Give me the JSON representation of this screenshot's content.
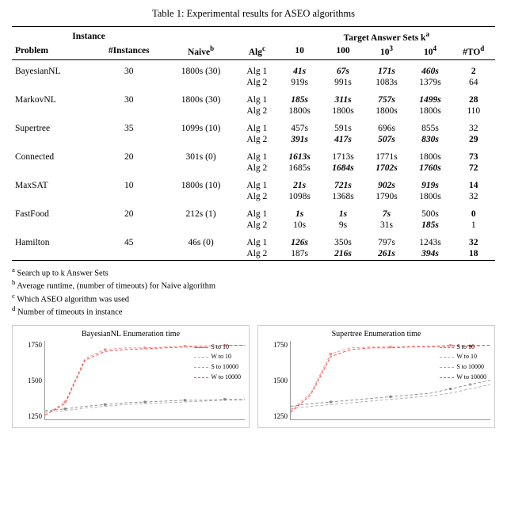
{
  "caption": "Table 1: Experimental results for ASEO algorithms",
  "header": {
    "col1": "Problem",
    "col2": "#Instances",
    "col3": "Naive",
    "col3_sup": "b",
    "col4": "Alg",
    "col4_sup": "c",
    "target_label": "Target Answer Sets k",
    "target_sup": "a",
    "col5": "10",
    "col6": "100",
    "col7": "10³",
    "col8": "10⁴",
    "col9": "#TO",
    "col9_sup": "d",
    "instance_label": "Instance"
  },
  "rows": [
    {
      "problem": "BayesianNL",
      "instances": "30",
      "naive": "1800s (30)",
      "alg": "Alg 1",
      "k10": "41s",
      "k100": "67s",
      "k1000": "171s",
      "k10000": "460s",
      "to": "2",
      "bold_cols": [
        "k10",
        "k100",
        "k1000",
        "k10000",
        "to"
      ],
      "italic_cols": [
        "k10",
        "k100",
        "k1000",
        "k10000"
      ],
      "group": "BayesianNL"
    },
    {
      "problem": "",
      "instances": "",
      "naive": "",
      "alg": "Alg 2",
      "k10": "919s",
      "k100": "991s",
      "k1000": "1083s",
      "k10000": "1379s",
      "to": "64",
      "bold_cols": [],
      "italic_cols": [],
      "group": "BayesianNL"
    },
    {
      "problem": "MarkovNL",
      "instances": "30",
      "naive": "1800s (30)",
      "alg": "Alg 1",
      "k10": "185s",
      "k100": "311s",
      "k1000": "757s",
      "k10000": "1499s",
      "to": "28",
      "bold_cols": [
        "k10",
        "k100",
        "k1000",
        "k10000",
        "to"
      ],
      "italic_cols": [
        "k10",
        "k100",
        "k1000",
        "k10000"
      ],
      "group": "MarkovNL"
    },
    {
      "problem": "",
      "instances": "",
      "naive": "",
      "alg": "Alg 2",
      "k10": "1800s",
      "k100": "1800s",
      "k1000": "1800s",
      "k10000": "1800s",
      "to": "110",
      "bold_cols": [],
      "italic_cols": [],
      "group": "MarkovNL"
    },
    {
      "problem": "Supertree",
      "instances": "35",
      "naive": "1099s (10)",
      "alg": "Alg 1",
      "k10": "457s",
      "k100": "591s",
      "k1000": "696s",
      "k10000": "855s",
      "to": "32",
      "bold_cols": [],
      "italic_cols": [],
      "group": "Supertree"
    },
    {
      "problem": "",
      "instances": "",
      "naive": "",
      "alg": "Alg 2",
      "k10": "391s",
      "k100": "417s",
      "k1000": "507s",
      "k10000": "830s",
      "to": "29",
      "bold_cols": [
        "k10",
        "k100",
        "k1000",
        "k10000",
        "to"
      ],
      "italic_cols": [
        "k10",
        "k100",
        "k1000",
        "k10000"
      ],
      "group": "Supertree"
    },
    {
      "problem": "Connected",
      "instances": "20",
      "naive": "301s (0)",
      "alg": "Alg 1",
      "k10": "1613s",
      "k100": "1713s",
      "k1000": "1771s",
      "k10000": "1800s",
      "to": "73",
      "bold_cols": [
        "k10",
        "to"
      ],
      "italic_cols": [
        "k10"
      ],
      "group": "Connected"
    },
    {
      "problem": "",
      "instances": "",
      "naive": "",
      "alg": "Alg 2",
      "k10": "1685s",
      "k100": "1684s",
      "k1000": "1702s",
      "k10000": "1760s",
      "to": "72",
      "bold_cols": [
        "k100",
        "k1000",
        "k10000",
        "to"
      ],
      "italic_cols": [
        "k100",
        "k1000",
        "k10000"
      ],
      "group": "Connected"
    },
    {
      "problem": "MaxSAT",
      "instances": "10",
      "naive": "1800s (10)",
      "alg": "Alg 1",
      "k10": "21s",
      "k100": "721s",
      "k1000": "902s",
      "k10000": "919s",
      "to": "14",
      "bold_cols": [
        "k10",
        "k100",
        "k1000",
        "k10000",
        "to"
      ],
      "italic_cols": [
        "k10",
        "k100",
        "k1000",
        "k10000"
      ],
      "group": "MaxSAT"
    },
    {
      "problem": "",
      "instances": "",
      "naive": "",
      "alg": "Alg 2",
      "k10": "1098s",
      "k100": "1368s",
      "k1000": "1790s",
      "k10000": "1800s",
      "to": "32",
      "bold_cols": [],
      "italic_cols": [],
      "group": "MaxSAT"
    },
    {
      "problem": "FastFood",
      "instances": "20",
      "naive": "212s (1)",
      "alg": "Alg 1",
      "k10": "1s",
      "k100": "1s",
      "k1000": "7s",
      "k10000": "500s",
      "to": "0",
      "bold_cols": [
        "k10",
        "k100",
        "k1000",
        "to"
      ],
      "italic_cols": [
        "k10",
        "k100",
        "k1000"
      ],
      "group": "FastFood"
    },
    {
      "problem": "",
      "instances": "",
      "naive": "",
      "alg": "Alg 2",
      "k10": "10s",
      "k100": "9s",
      "k1000": "31s",
      "k10000": "185s",
      "to": "1",
      "bold_cols": [
        "k10000"
      ],
      "italic_cols": [
        "k10000"
      ],
      "group": "FastFood"
    },
    {
      "problem": "Hamilton",
      "instances": "45",
      "naive": "46s (0)",
      "alg": "Alg 1",
      "k10": "126s",
      "k100": "350s",
      "k1000": "797s",
      "k10000": "1243s",
      "to": "32",
      "bold_cols": [
        "k10",
        "to"
      ],
      "italic_cols": [
        "k10"
      ],
      "group": "Hamilton"
    },
    {
      "problem": "",
      "instances": "",
      "naive": "",
      "alg": "Alg 2",
      "k10": "187s",
      "k100": "216s",
      "k1000": "261s",
      "k10000": "394s",
      "to": "18",
      "bold_cols": [
        "k100",
        "k1000",
        "k10000",
        "to"
      ],
      "italic_cols": [
        "k100",
        "k1000",
        "k10000"
      ],
      "group": "Hamilton"
    }
  ],
  "footnotes": [
    {
      "label": "a",
      "text": "Search up to k Answer Sets"
    },
    {
      "label": "b",
      "text": "Average runtime, (number of timeouts) for Naive algorithm"
    },
    {
      "label": "c",
      "text": "Which ASEO algorithm was used"
    },
    {
      "label": "d",
      "text": "Number of timeouts in instance"
    }
  ],
  "charts": [
    {
      "title": "BayesianNL Enumeration time",
      "y_labels": [
        "1750",
        "1500",
        "1250"
      ],
      "legend": [
        {
          "label": "S to 10",
          "color": "#888",
          "style": "dashed"
        },
        {
          "label": "W to 10",
          "color": "#aaa",
          "style": "dashed"
        },
        {
          "label": "S to 10000",
          "color": "#f88",
          "style": "dashed"
        },
        {
          "label": "W to 10000",
          "color": "#f44",
          "style": "dashed"
        }
      ]
    },
    {
      "title": "Supertree Enumeration time",
      "y_labels": [
        "1750",
        "1500",
        "1250"
      ],
      "legend": [
        {
          "label": "S to 10",
          "color": "#888",
          "style": "dashed"
        },
        {
          "label": "W to 10",
          "color": "#aaa",
          "style": "dashed"
        },
        {
          "label": "S to 10000",
          "color": "#f88",
          "style": "dashed"
        },
        {
          "label": "W to 10000",
          "color": "#f44",
          "style": "dashed"
        }
      ]
    }
  ]
}
